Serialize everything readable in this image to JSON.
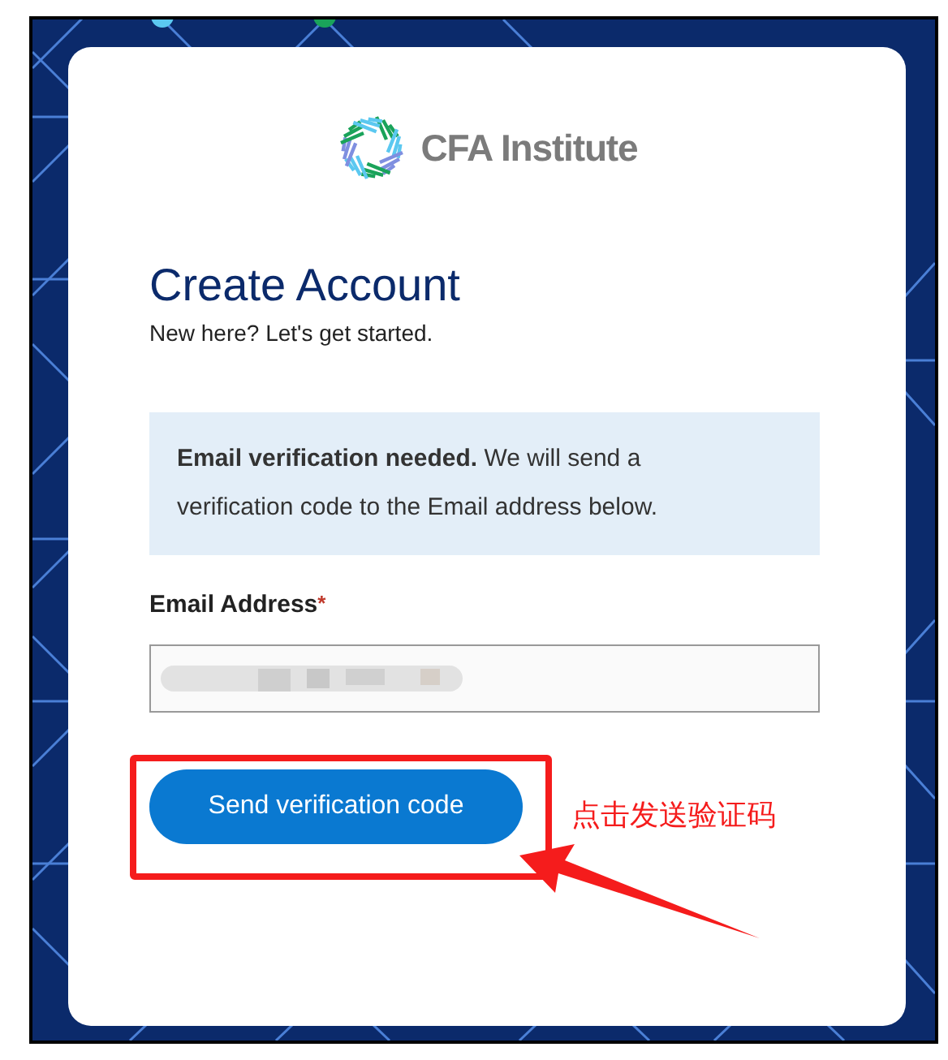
{
  "logo": {
    "text": "CFA Institute"
  },
  "heading": "Create Account",
  "subheading": "New here? Let's get started.",
  "notice": "**Email verification needed.** We will send a verification code to the Email address below.",
  "email_field": {
    "label": "Email Address",
    "required_mark": "*",
    "redacted": true
  },
  "submit_button": {
    "label": "Send verification code"
  },
  "annotation": {
    "text": "点击发送验证码"
  }
}
